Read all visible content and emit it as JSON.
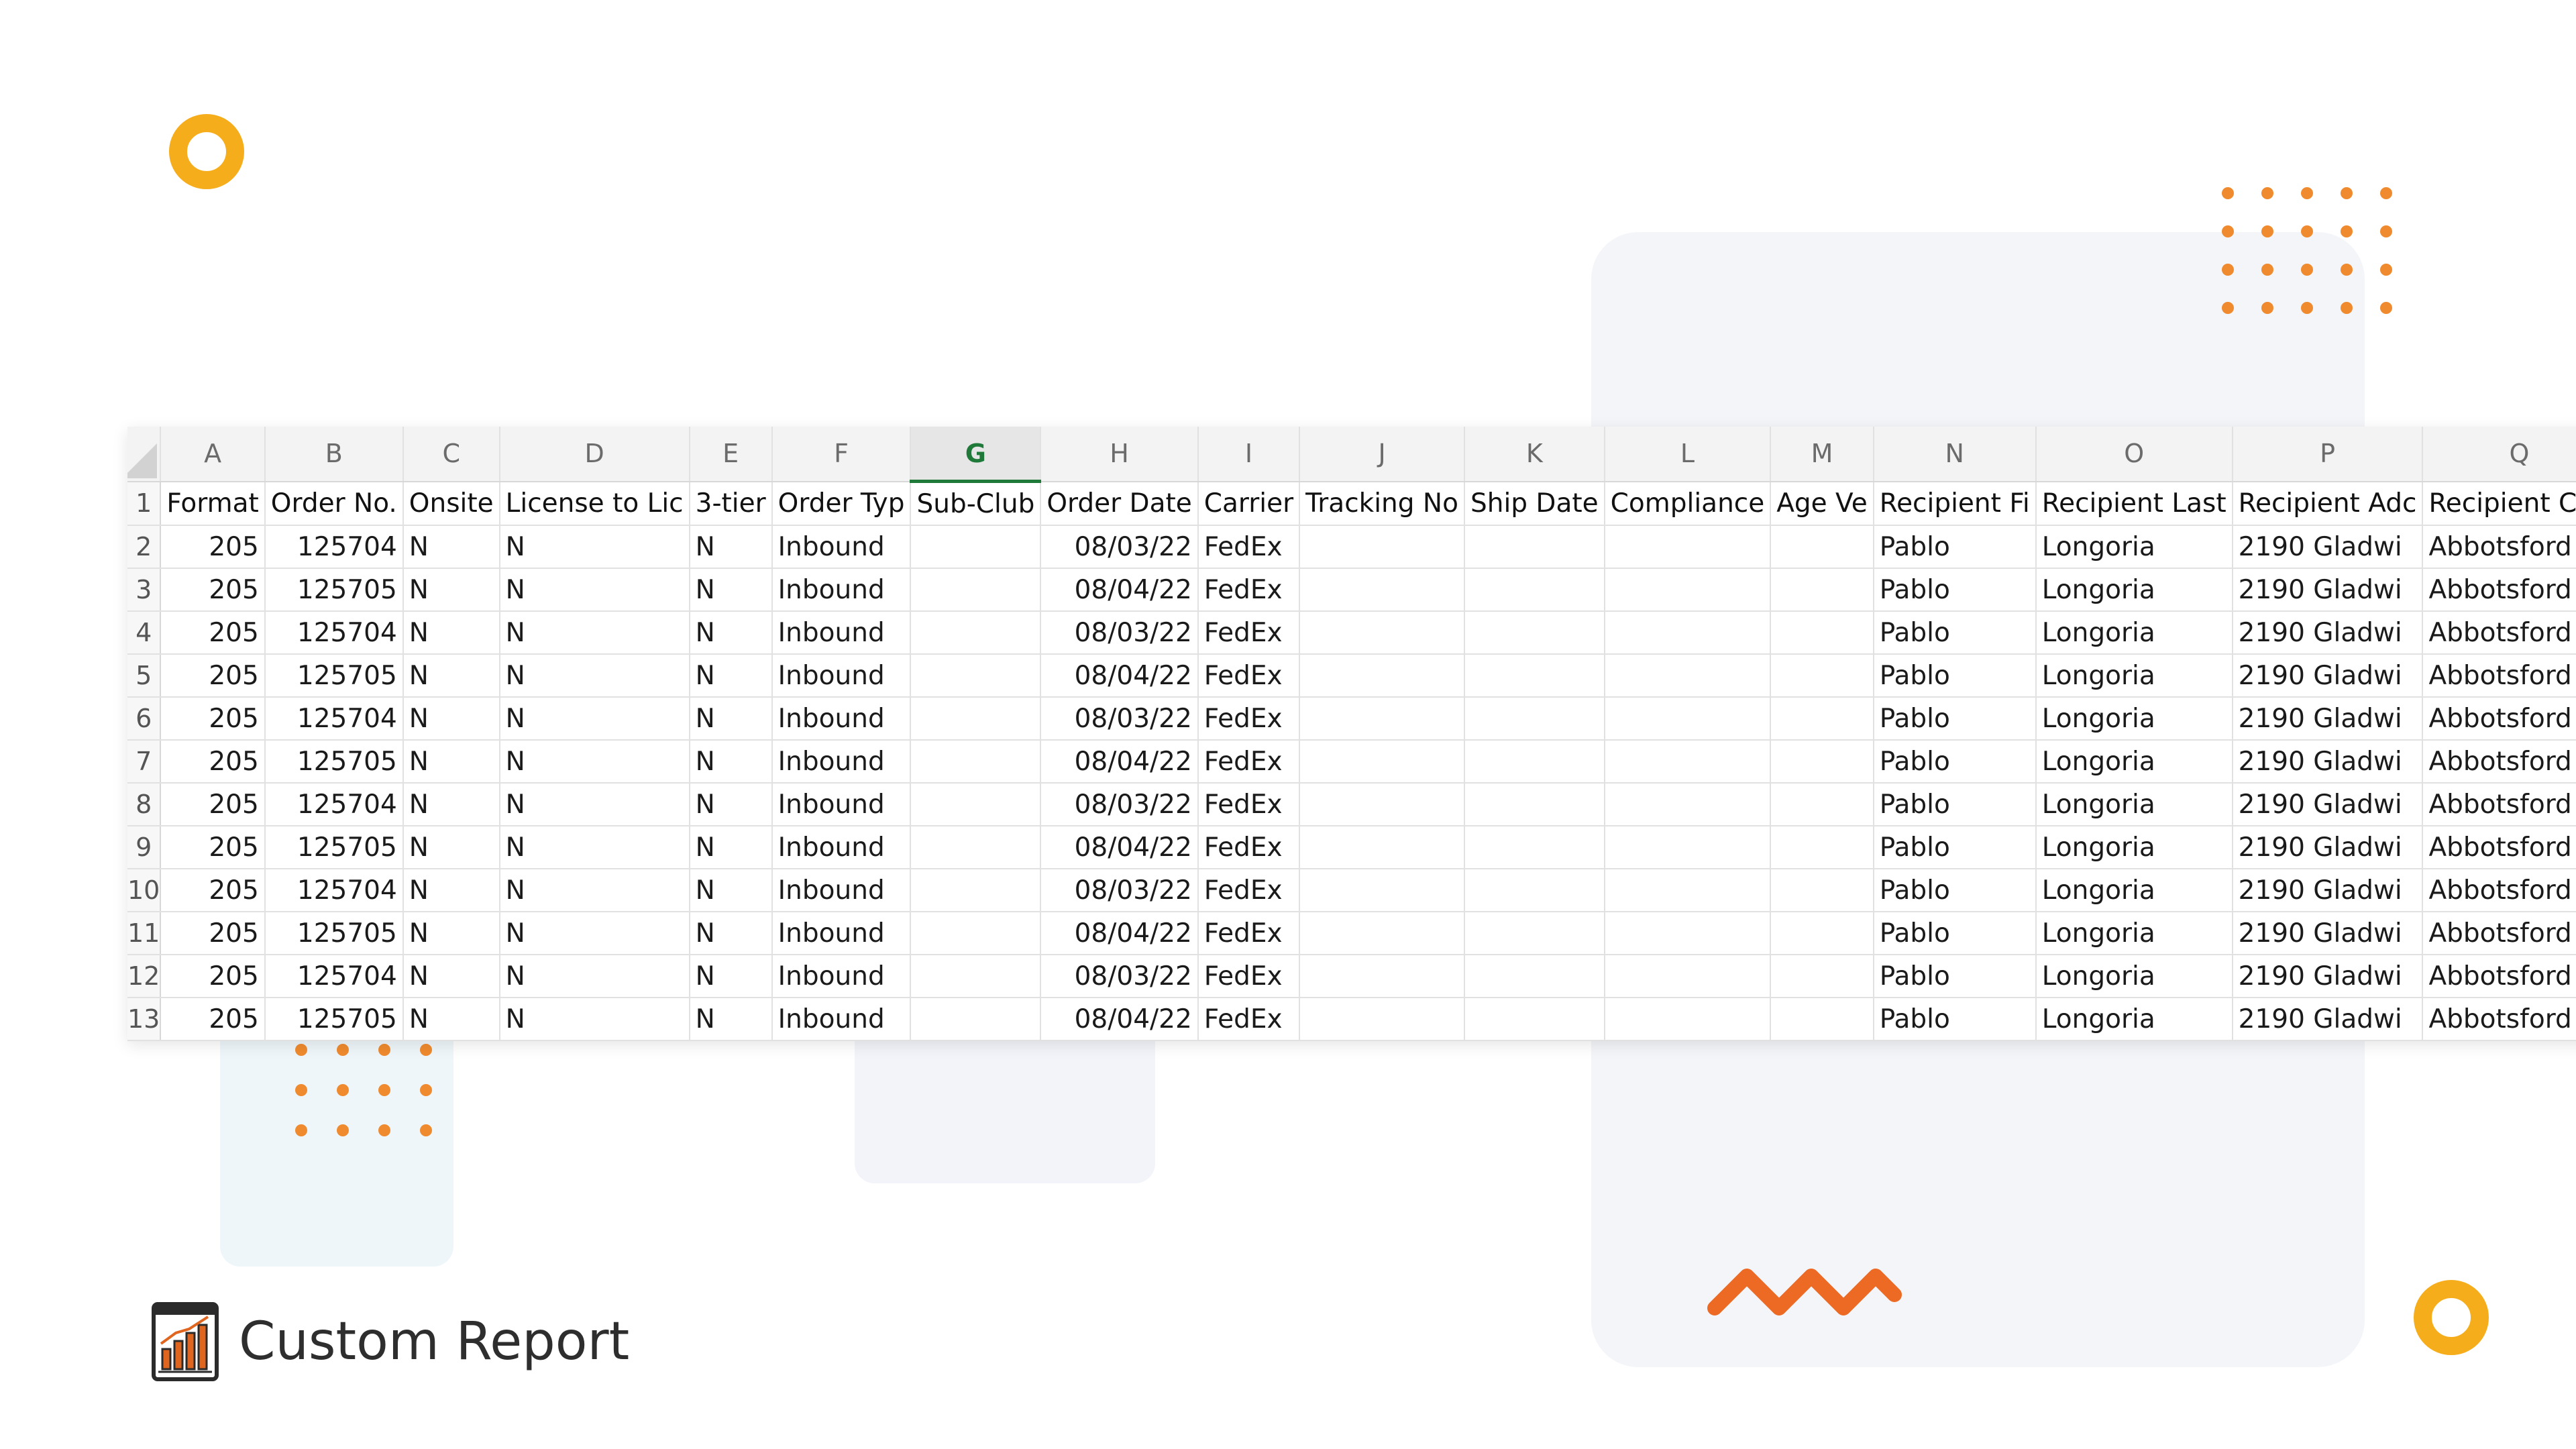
{
  "colors": {
    "accent_orange": "#ef8a2e",
    "ring_yellow": "#f6ad1c",
    "zigzag_orange": "#ec6a24",
    "selected_column": "#1f7a3a",
    "panel_gray": "#f4f5f8",
    "panel_blue": "#eef6fa"
  },
  "spreadsheet": {
    "selected_column": "G",
    "columns": [
      "A",
      "B",
      "C",
      "D",
      "E",
      "F",
      "G",
      "H",
      "I",
      "J",
      "K",
      "L",
      "M",
      "N",
      "O",
      "P",
      "Q"
    ],
    "header_row_number": "1",
    "headers": [
      "Format",
      "Order No.",
      "Onsite",
      "License to Lic",
      "3-tier",
      "Order Typ",
      "Sub-Club",
      "Order Date",
      "Carrier",
      "Tracking No",
      "Ship Date",
      "Compliance",
      "Age Ve",
      "Recipient Fi",
      "Recipient Last",
      "Recipient Adc",
      "Recipient City"
    ],
    "rows": [
      {
        "row": "2",
        "cells": [
          "205",
          "125704",
          "N",
          "N",
          "N",
          "Inbound",
          "",
          "08/03/22",
          "FedEx",
          "",
          "",
          "",
          "",
          "Pablo",
          "Longoria",
          "2190 Gladwi",
          "Abbotsford"
        ]
      },
      {
        "row": "3",
        "cells": [
          "205",
          "125705",
          "N",
          "N",
          "N",
          "Inbound",
          "",
          "08/04/22",
          "FedEx",
          "",
          "",
          "",
          "",
          "Pablo",
          "Longoria",
          "2190 Gladwi",
          "Abbotsford"
        ]
      },
      {
        "row": "4",
        "cells": [
          "205",
          "125704",
          "N",
          "N",
          "N",
          "Inbound",
          "",
          "08/03/22",
          "FedEx",
          "",
          "",
          "",
          "",
          "Pablo",
          "Longoria",
          "2190 Gladwi",
          "Abbotsford"
        ]
      },
      {
        "row": "5",
        "cells": [
          "205",
          "125705",
          "N",
          "N",
          "N",
          "Inbound",
          "",
          "08/04/22",
          "FedEx",
          "",
          "",
          "",
          "",
          "Pablo",
          "Longoria",
          "2190 Gladwi",
          "Abbotsford"
        ]
      },
      {
        "row": "6",
        "cells": [
          "205",
          "125704",
          "N",
          "N",
          "N",
          "Inbound",
          "",
          "08/03/22",
          "FedEx",
          "",
          "",
          "",
          "",
          "Pablo",
          "Longoria",
          "2190 Gladwi",
          "Abbotsford"
        ]
      },
      {
        "row": "7",
        "cells": [
          "205",
          "125705",
          "N",
          "N",
          "N",
          "Inbound",
          "",
          "08/04/22",
          "FedEx",
          "",
          "",
          "",
          "",
          "Pablo",
          "Longoria",
          "2190 Gladwi",
          "Abbotsford"
        ]
      },
      {
        "row": "8",
        "cells": [
          "205",
          "125704",
          "N",
          "N",
          "N",
          "Inbound",
          "",
          "08/03/22",
          "FedEx",
          "",
          "",
          "",
          "",
          "Pablo",
          "Longoria",
          "2190 Gladwi",
          "Abbotsford"
        ]
      },
      {
        "row": "9",
        "cells": [
          "205",
          "125705",
          "N",
          "N",
          "N",
          "Inbound",
          "",
          "08/04/22",
          "FedEx",
          "",
          "",
          "",
          "",
          "Pablo",
          "Longoria",
          "2190 Gladwi",
          "Abbotsford"
        ]
      },
      {
        "row": "10",
        "cells": [
          "205",
          "125704",
          "N",
          "N",
          "N",
          "Inbound",
          "",
          "08/03/22",
          "FedEx",
          "",
          "",
          "",
          "",
          "Pablo",
          "Longoria",
          "2190 Gladwi",
          "Abbotsford"
        ]
      },
      {
        "row": "11",
        "cells": [
          "205",
          "125705",
          "N",
          "N",
          "N",
          "Inbound",
          "",
          "08/04/22",
          "FedEx",
          "",
          "",
          "",
          "",
          "Pablo",
          "Longoria",
          "2190 Gladwi",
          "Abbotsford"
        ]
      },
      {
        "row": "12",
        "cells": [
          "205",
          "125704",
          "N",
          "N",
          "N",
          "Inbound",
          "",
          "08/03/22",
          "FedEx",
          "",
          "",
          "",
          "",
          "Pablo",
          "Longoria",
          "2190 Gladwi",
          "Abbotsford"
        ]
      },
      {
        "row": "13",
        "cells": [
          "205",
          "125705",
          "N",
          "N",
          "N",
          "Inbound",
          "",
          "08/04/22",
          "FedEx",
          "",
          "",
          "",
          "",
          "Pablo",
          "Longoria",
          "2190 Gladwi",
          "Abbotsford"
        ]
      }
    ]
  },
  "caption": {
    "icon": "bar-chart-report-icon",
    "text": "Custom Report"
  }
}
